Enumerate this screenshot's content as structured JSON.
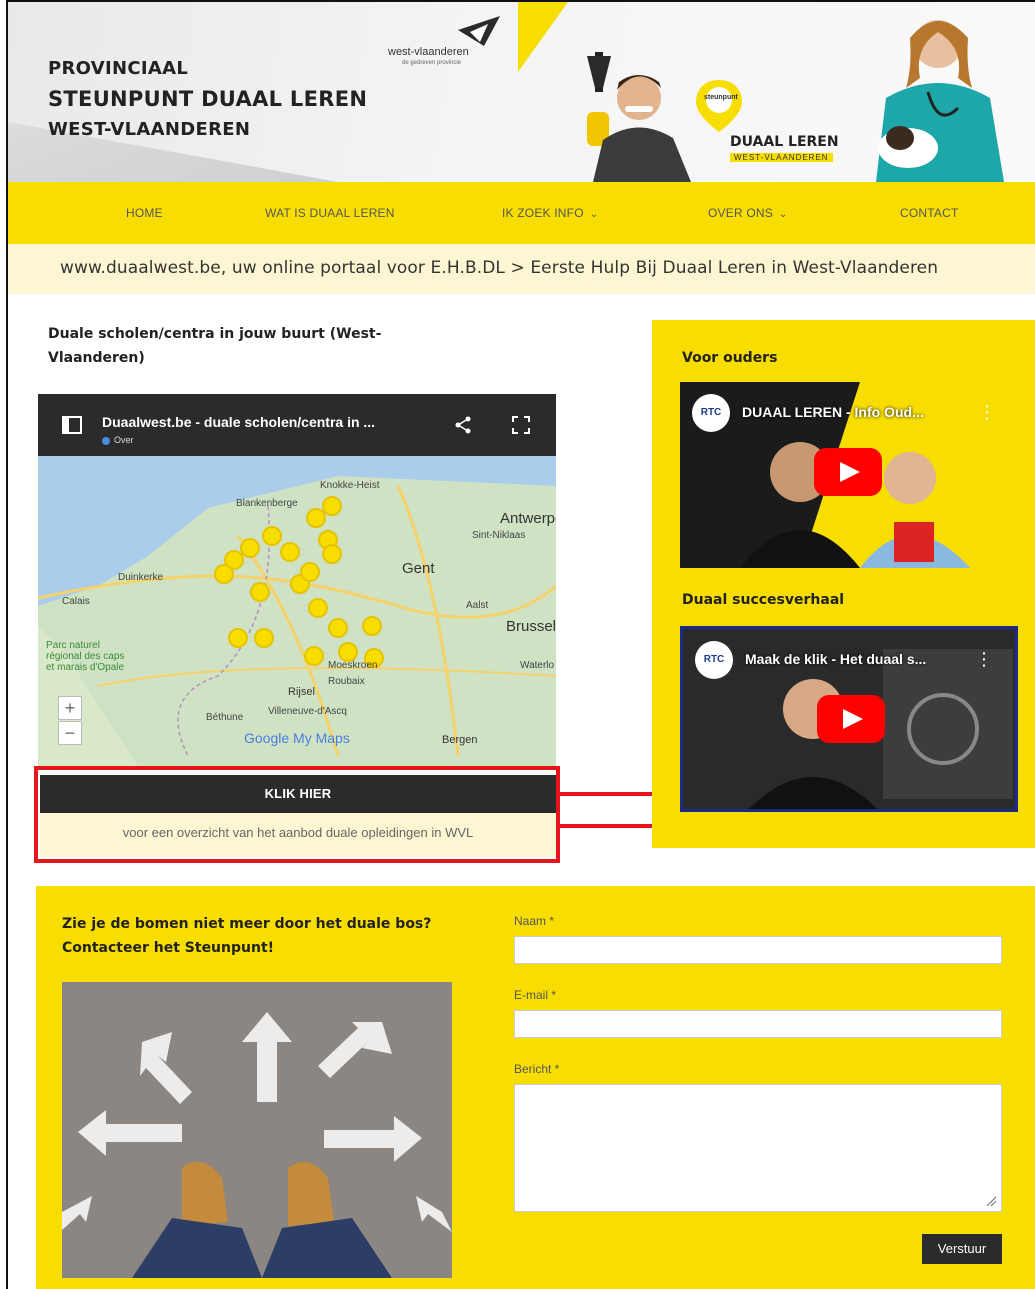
{
  "header": {
    "brand_line1": "PROVINCIAAL",
    "brand_line2": "STEUNPUNT DUAAL LEREN",
    "brand_line3": "WEST-VLAANDEREN",
    "partner_logo_text": "west-vlaanderen",
    "partner_logo_sub": "de gedreven provincie",
    "badge_pin_text": "steunpunt",
    "badge_title": "DUAAL LEREN",
    "badge_sub": "WEST-VLAANDEREN",
    "accent_color": "#f7dd00"
  },
  "nav": {
    "items": [
      {
        "label": "HOME"
      },
      {
        "label": "WAT IS DUAAL LEREN"
      },
      {
        "label": "IK ZOEK INFO",
        "chevron": "chevron-down-icon"
      },
      {
        "label": "OVER ONS",
        "chevron": "chevron-down-icon"
      },
      {
        "label": "CONTACT"
      }
    ]
  },
  "tagline": "www.duaalwest.be, uw online portaal voor E.H.B.DL > Eerste Hulp Bij Duaal Leren in West-Vlaanderen",
  "left": {
    "title": "Duale scholen/centra in jouw buurt (West-Vlaanderen)",
    "map": {
      "title": "Duaalwest.be - duale scholen/centra in ...",
      "over": "Over",
      "places": [
        "Knokke-Heist",
        "Blankenberge",
        "Antwerpen",
        "Sint-Niklaas",
        "Gent",
        "Duinkerke",
        "Calais",
        "Aalst",
        "Brussel",
        "Parc naturel régional des caps et marais d'Opale",
        "Moeskroen",
        "Roubaix",
        "Rijsel",
        "Béthune",
        "Villeneuve-d'Ascq",
        "Bergen",
        "Waterlo"
      ],
      "google": "Google My Maps",
      "zoom_in": "+",
      "zoom_out": "−"
    },
    "cta_button": "KLIK HIER",
    "cta_sub": "voor een overzicht van het aanbod duale opleidingen in WVL"
  },
  "sidebar": {
    "heading1": "Voor ouders",
    "video1_title": "DUAAL LEREN - Info Oud...",
    "heading2": "Duaal succesverhaal",
    "video2_title": "Maak de klik - Het duaal s...",
    "rtc": "RTC"
  },
  "contact": {
    "title": "Zie je de bomen niet meer door het duale bos? Contacteer het Steunpunt!",
    "name_label": "Naam *",
    "email_label": "E-mail *",
    "message_label": "Bericht *",
    "submit": "Verstuur"
  }
}
